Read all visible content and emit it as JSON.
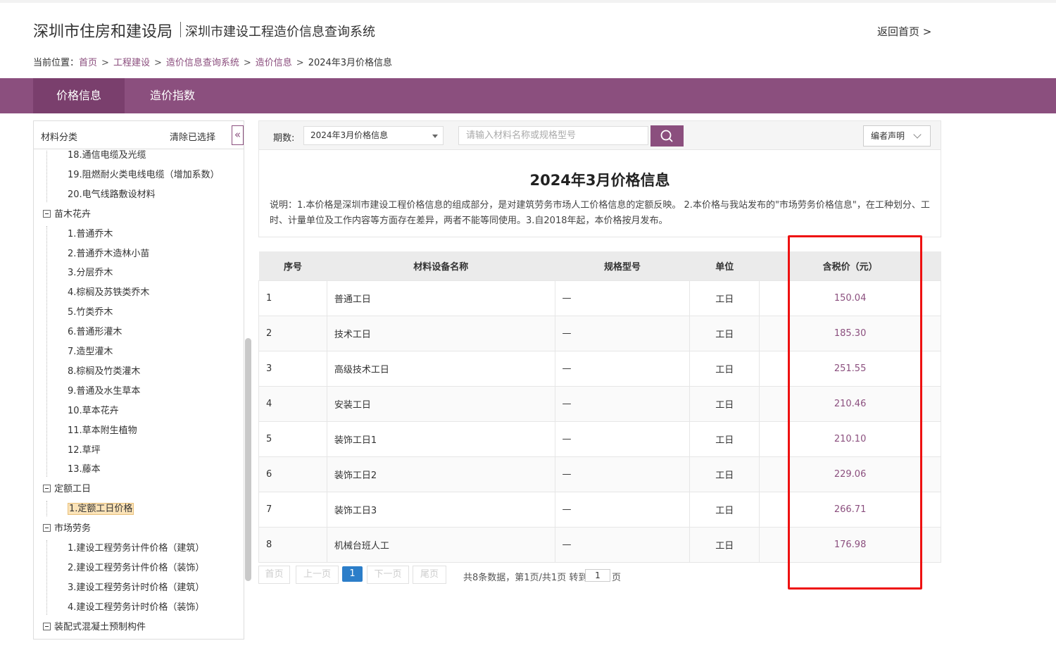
{
  "header": {
    "title": "深圳市住房和建设局",
    "subtitle": "深圳市建设工程造价信息查询系统",
    "back_home": "返回首页 >"
  },
  "breadcrumb": {
    "prefix": "当前位置：",
    "items": [
      "首页",
      "工程建设",
      "造价信息查询系统",
      "造价信息"
    ],
    "current": "2024年3月价格信息",
    "separator": ">"
  },
  "nav": {
    "tabs": [
      {
        "label": "价格信息",
        "active": true
      },
      {
        "label": "造价指数",
        "active": false
      }
    ]
  },
  "sidebar": {
    "title": "材料分类",
    "clear": "清除已选择",
    "collapse_icon": "«",
    "tree": [
      {
        "type": "item",
        "label": "18.通信电缆及光缆"
      },
      {
        "type": "item",
        "label": "19.阻燃耐火类电线电缆（增加系数）"
      },
      {
        "type": "item",
        "label": "20.电气线路敷设材料"
      },
      {
        "type": "cat",
        "label": "苗木花卉"
      },
      {
        "type": "item",
        "label": "1.普通乔木"
      },
      {
        "type": "item",
        "label": "2.普通乔木造林小苗"
      },
      {
        "type": "item",
        "label": "3.分层乔木"
      },
      {
        "type": "item",
        "label": "4.棕榈及苏铁类乔木"
      },
      {
        "type": "item",
        "label": "5.竹类乔木"
      },
      {
        "type": "item",
        "label": "6.普通形灌木"
      },
      {
        "type": "item",
        "label": "7.造型灌木"
      },
      {
        "type": "item",
        "label": "8.棕榈及竹类灌木"
      },
      {
        "type": "item",
        "label": "9.普通及水生草本"
      },
      {
        "type": "item",
        "label": "10.草本花卉"
      },
      {
        "type": "item",
        "label": "11.草本附生植物"
      },
      {
        "type": "item",
        "label": "12.草坪"
      },
      {
        "type": "item",
        "label": "13.藤本"
      },
      {
        "type": "cat",
        "label": "定额工日"
      },
      {
        "type": "item",
        "label": "1.定额工日价格",
        "selected": true
      },
      {
        "type": "cat",
        "label": "市场劳务"
      },
      {
        "type": "item",
        "label": "1.建设工程劳务计件价格（建筑）"
      },
      {
        "type": "item",
        "label": "2.建设工程劳务计件价格（装饰）"
      },
      {
        "type": "item",
        "label": "3.建设工程劳务计时价格（建筑）"
      },
      {
        "type": "item",
        "label": "4.建设工程劳务计时价格（装饰）"
      },
      {
        "type": "cat",
        "label": "装配式混凝土预制构件"
      }
    ]
  },
  "filter": {
    "period_label": "期数:",
    "period_value": "2024年3月价格信息",
    "search_placeholder": "请输入材料名称或规格型号",
    "editor_note": "编者声明"
  },
  "info": {
    "title": "2024年3月价格信息",
    "description": "说明：1.本价格是深圳市建设工程价格信息的组成部分，是对建筑劳务市场人工价格信息的定额反映。 2.本价格与我站发布的\"市场劳务价格信息\"，在工种划分、工时、计量单位及工作内容等方面存在差异，两者不能等同使用。3.自2018年起，本价格按月发布。"
  },
  "table": {
    "headers": [
      "序号",
      "材料设备名称",
      "规格型号",
      "单位",
      "含税价（元）"
    ],
    "rows": [
      {
        "no": "1",
        "name": "普通工日",
        "spec": "—",
        "unit": "工日",
        "price": "150.04"
      },
      {
        "no": "2",
        "name": "技术工日",
        "spec": "—",
        "unit": "工日",
        "price": "185.30"
      },
      {
        "no": "3",
        "name": "高级技术工日",
        "spec": "—",
        "unit": "工日",
        "price": "251.55"
      },
      {
        "no": "4",
        "name": "安装工日",
        "spec": "—",
        "unit": "工日",
        "price": "210.46"
      },
      {
        "no": "5",
        "name": "装饰工日1",
        "spec": "—",
        "unit": "工日",
        "price": "210.10"
      },
      {
        "no": "6",
        "name": "装饰工日2",
        "spec": "—",
        "unit": "工日",
        "price": "229.06"
      },
      {
        "no": "7",
        "name": "装饰工日3",
        "spec": "—",
        "unit": "工日",
        "price": "266.71"
      },
      {
        "no": "8",
        "name": "机械台班人工",
        "spec": "—",
        "unit": "工日",
        "price": "176.98"
      }
    ]
  },
  "pager": {
    "first": "首页",
    "prev": "上一页",
    "current": "1",
    "next": "下一页",
    "last": "尾页",
    "summary": "共8条数据，第1页/共1页 转到",
    "jump_value": "1",
    "unit": "页"
  },
  "colors": {
    "brand": "#8b4f7e",
    "highlight": "#ee1111",
    "pager_active": "#2c7ec9"
  }
}
